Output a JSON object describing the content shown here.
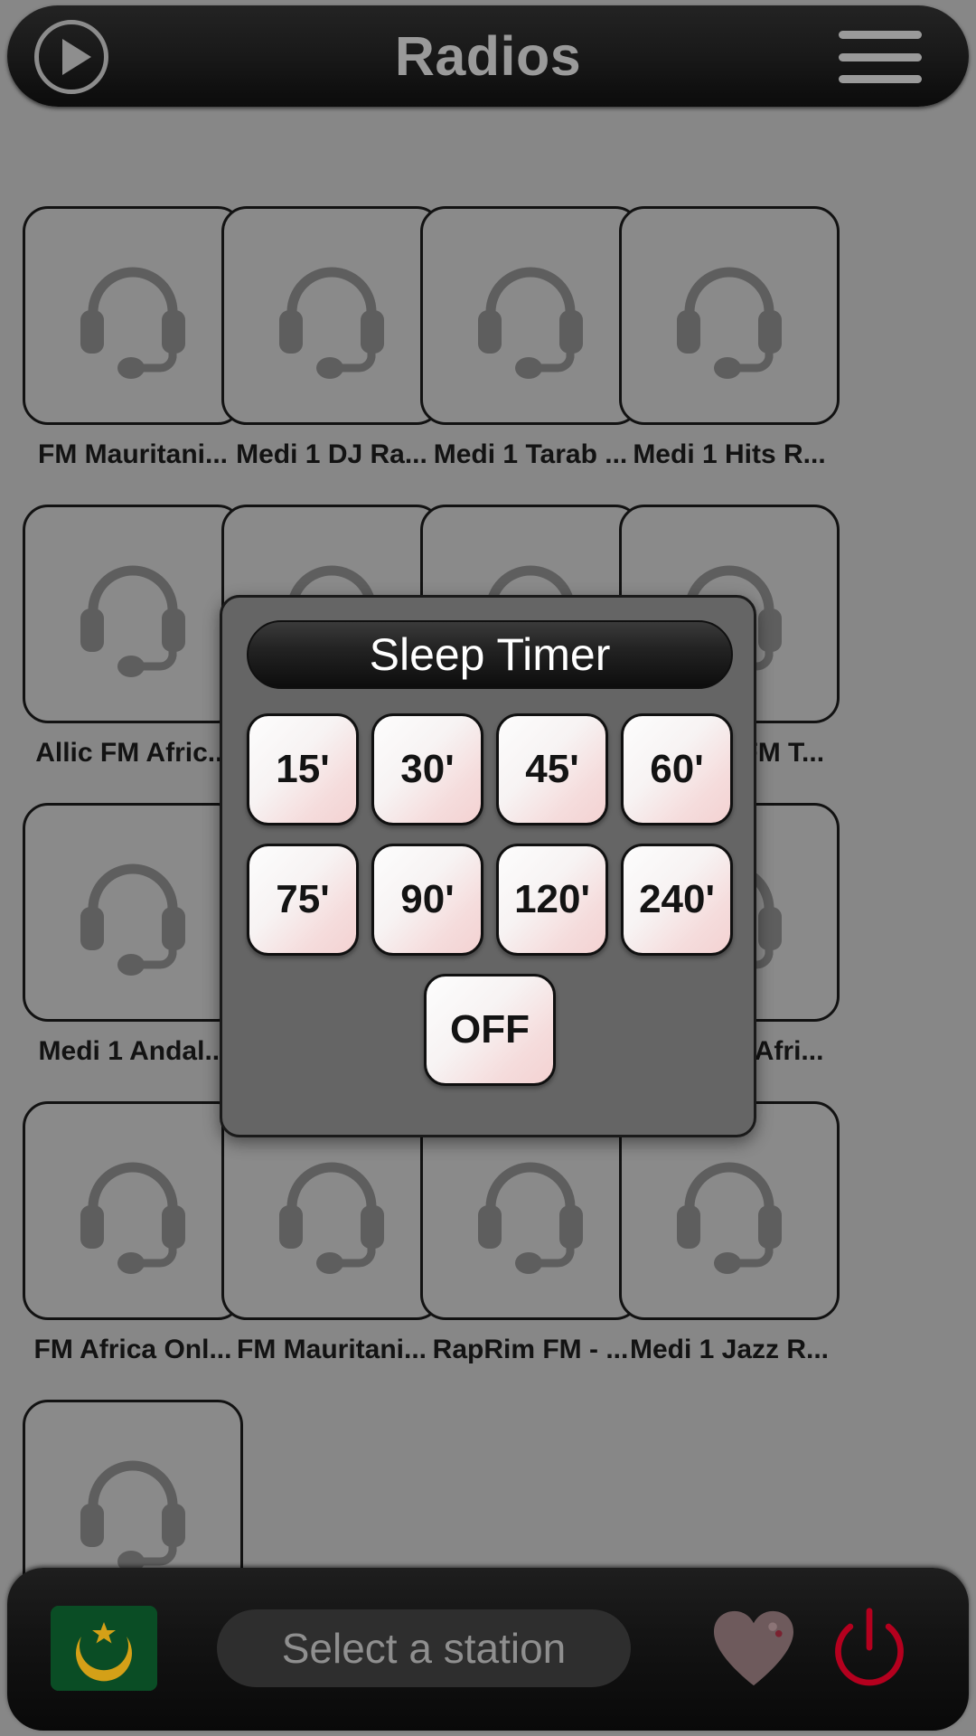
{
  "header": {
    "title": "Radios",
    "play_icon": "play-icon",
    "menu_icon": "hamburger-menu-icon"
  },
  "grid": {
    "rows": [
      [
        {
          "label": "FM Mauritani...",
          "icon": "headset-icon"
        },
        {
          "label": "Medi 1 DJ Ra...",
          "icon": "headset-icon"
        },
        {
          "label": "Medi 1 Tarab ...",
          "icon": "headset-icon"
        },
        {
          "label": "Medi 1 Hits R...",
          "icon": "headset-icon"
        }
      ],
      [
        {
          "label": "Allic FM Afric...",
          "icon": "headset-icon"
        },
        {
          "label": "",
          "icon": "headset-icon"
        },
        {
          "label": "",
          "icon": "headset-icon"
        },
        {
          "label": "Seereer FM T...",
          "icon": "headset-icon"
        }
      ],
      [
        {
          "label": "Medi 1 Andal...",
          "icon": "headset-icon"
        },
        {
          "label": "",
          "icon": "headset-icon"
        },
        {
          "label": "",
          "icon": "headset-icon"
        },
        {
          "label": "Eben FM Afri...",
          "icon": "headset-icon"
        }
      ],
      [
        {
          "label": "FM Africa Onl...",
          "icon": "headset-icon"
        },
        {
          "label": "FM Mauritani...",
          "icon": "headset-icon"
        },
        {
          "label": "RapRim FM - ...",
          "icon": "headset-icon"
        },
        {
          "label": "Medi 1 Jazz R...",
          "icon": "headset-icon"
        }
      ],
      [
        {
          "label": "",
          "icon": "headset-icon"
        }
      ]
    ]
  },
  "dialog": {
    "title": "Sleep Timer",
    "rows": [
      [
        "15'",
        "30'",
        "45'",
        "60'"
      ],
      [
        "75'",
        "90'",
        "120'",
        "240'"
      ]
    ],
    "off_label": "OFF"
  },
  "bottombar": {
    "flag_icon": "mauritania-flag-icon",
    "search_placeholder": "Select a station",
    "favorite_icon": "heart-icon",
    "power_icon": "power-icon"
  },
  "colors": {
    "background": "#878787",
    "bar": "#141414",
    "dialog": "#656565",
    "accent_pink": "#f3d2d2",
    "power_red": "#b4001e",
    "flag_green": "#0a4d25",
    "flag_gold": "#d4a017"
  }
}
